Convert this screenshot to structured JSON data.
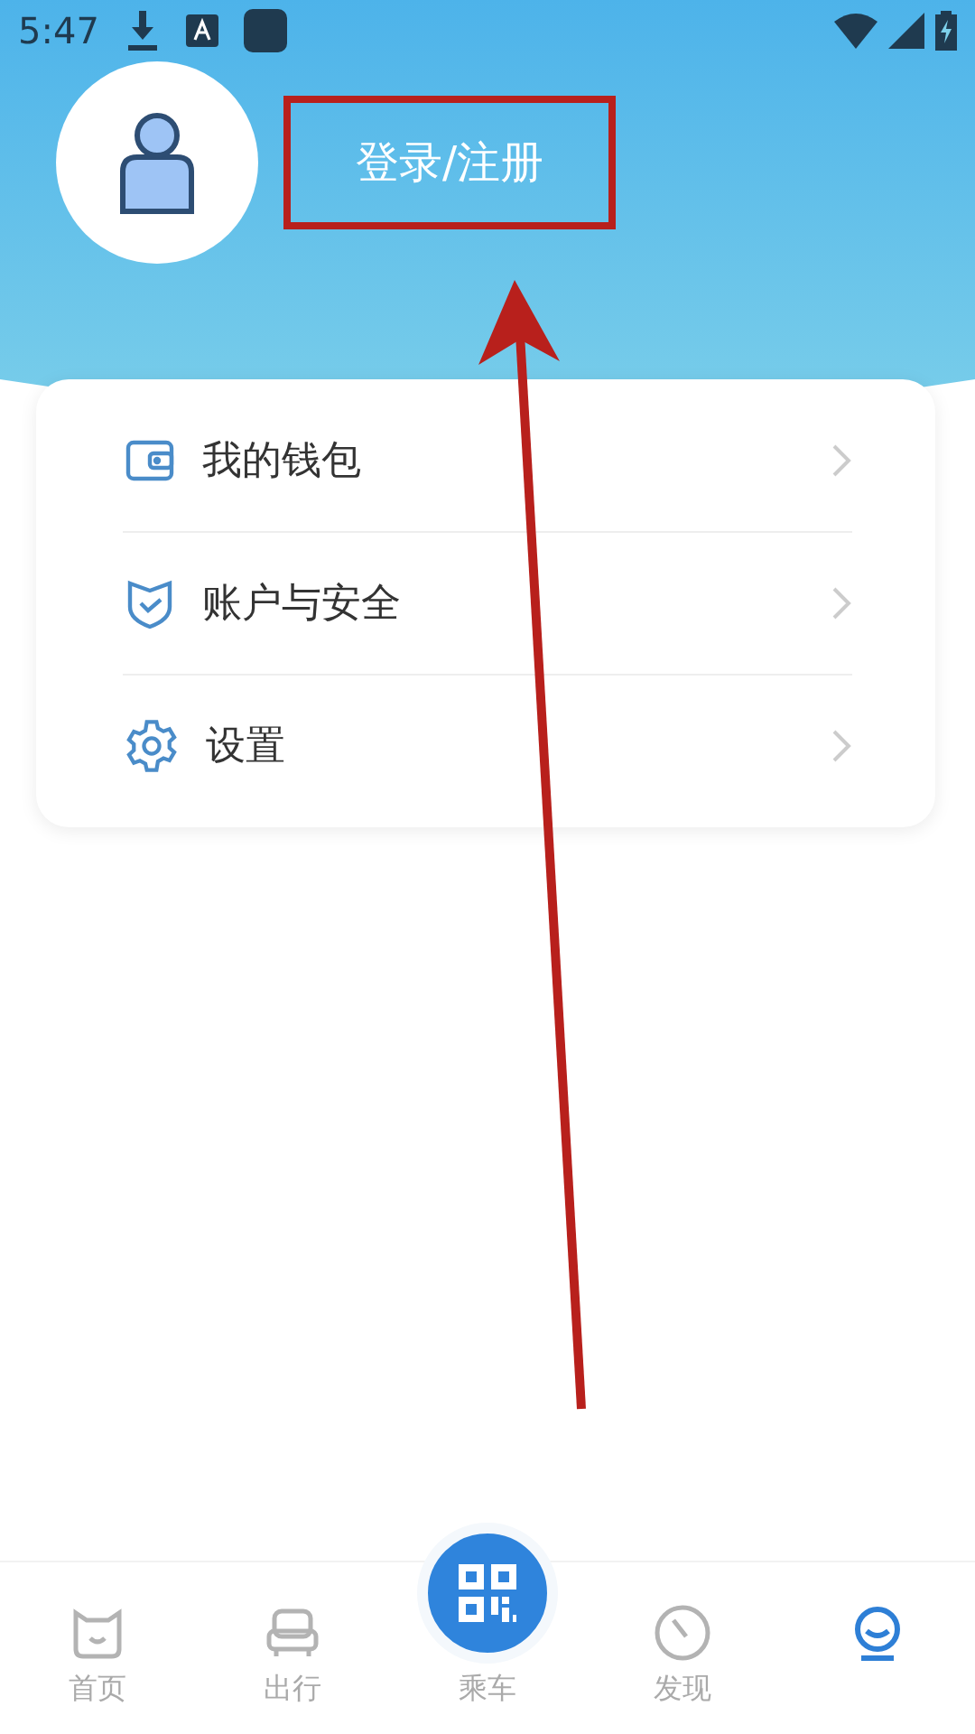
{
  "status_bar": {
    "time": "5:47"
  },
  "profile": {
    "login_label": "登录/注册",
    "highlighted": true
  },
  "menu": [
    {
      "label": "我的钱包"
    },
    {
      "label": "账户与安全"
    },
    {
      "label": "设置"
    }
  ],
  "tabs": [
    {
      "kind": "normal",
      "label": "首页",
      "selected": false
    },
    {
      "kind": "normal",
      "label": "出行",
      "selected": false
    },
    {
      "kind": "center",
      "label": "乘车",
      "selected": false
    },
    {
      "kind": "normal",
      "label": "发现",
      "selected": false
    },
    {
      "kind": "normal",
      "selected": true
    }
  ]
}
